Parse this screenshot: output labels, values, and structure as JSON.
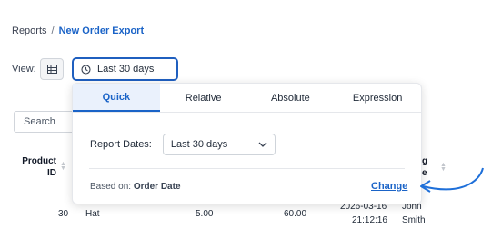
{
  "breadcrumb": {
    "parent": "Reports",
    "separator": "/",
    "current": "New Order Export"
  },
  "view": {
    "label": "View:",
    "table_icon": "table-grid-icon",
    "date_icon": "clock-icon",
    "date_value": "Last 30 days"
  },
  "search": {
    "placeholder": "Search"
  },
  "table": {
    "columns": {
      "product_id_line1": "Product",
      "product_id_line2": "ID",
      "ship_line1": "g",
      "ship_line2": "e"
    },
    "row": {
      "product_id": "30",
      "item": "Hat",
      "price": "5.00",
      "total": "60.00",
      "date_line1": "2026-03-16",
      "date_line2": "21:12:16",
      "name_line1": "John",
      "name_line2": "Smith"
    }
  },
  "popover": {
    "tabs": [
      "Quick",
      "Relative",
      "Absolute",
      "Expression"
    ],
    "active_tab": "Quick",
    "report_dates_label": "Report Dates:",
    "report_dates_value": "Last 30 days",
    "based_on_label": "Based on:",
    "based_on_value": "Order Date",
    "change_label": "Change"
  },
  "colors": {
    "accent": "#1a63c7",
    "annotation_arrow": "#1e6fd9"
  }
}
